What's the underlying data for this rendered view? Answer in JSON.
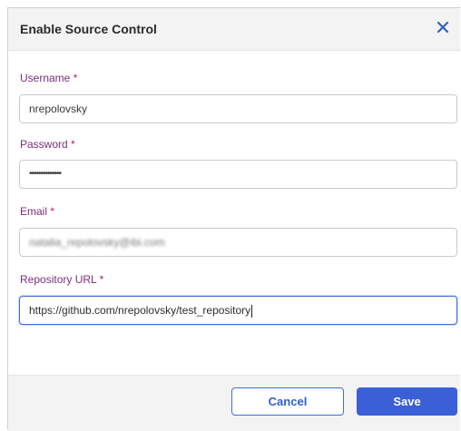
{
  "dialog": {
    "title": "Enable Source Control",
    "close_icon": "close-icon",
    "close_color": "#2f5fc4"
  },
  "fields": {
    "username": {
      "label": "Username",
      "required_mark": "*",
      "value": "nrepolovsky"
    },
    "password": {
      "label": "Password",
      "required_mark": "*",
      "value": "••••••••••••••"
    },
    "email": {
      "label": "Email",
      "required_mark": "*",
      "value": "natalia_repolovsky@ibi.com"
    },
    "repository_url": {
      "label": "Repository URL",
      "required_mark": "*",
      "value": "https://github.com/nrepolovsky/test_repository"
    }
  },
  "footer": {
    "cancel_label": "Cancel",
    "save_label": "Save"
  },
  "colors": {
    "accent": "#3b5fd6",
    "label": "#7a2d7a",
    "required": "#c2185b"
  }
}
